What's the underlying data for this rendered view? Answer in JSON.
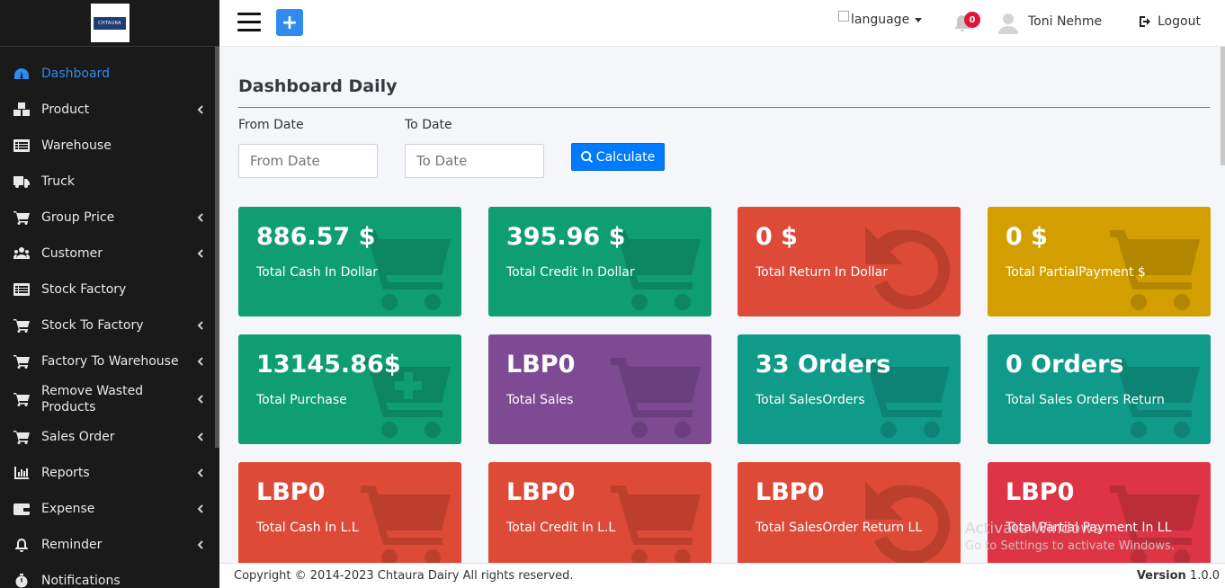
{
  "brand": {
    "logo_text": "CHTAURA"
  },
  "sidebar": {
    "items": [
      {
        "label": "Dashboard",
        "icon": "tachometer-icon",
        "active": true,
        "has_children": false
      },
      {
        "label": "Product",
        "icon": "cubes-icon",
        "active": false,
        "has_children": true
      },
      {
        "label": "Warehouse",
        "icon": "list-icon",
        "active": false,
        "has_children": false
      },
      {
        "label": "Truck",
        "icon": "truck-icon",
        "active": false,
        "has_children": false
      },
      {
        "label": "Group Price",
        "icon": "cart-icon",
        "active": false,
        "has_children": true
      },
      {
        "label": "Customer",
        "icon": "users-icon",
        "active": false,
        "has_children": true
      },
      {
        "label": "Stock Factory",
        "icon": "list-icon",
        "active": false,
        "has_children": false
      },
      {
        "label": "Stock To Factory",
        "icon": "cart-icon",
        "active": false,
        "has_children": true
      },
      {
        "label": "Factory To Warehouse",
        "icon": "cart-icon",
        "active": false,
        "has_children": true
      },
      {
        "label": "Remove Wasted Products",
        "icon": "cart-icon",
        "active": false,
        "has_children": true
      },
      {
        "label": "Sales Order",
        "icon": "cart-icon",
        "active": false,
        "has_children": true
      },
      {
        "label": "Reports",
        "icon": "chart-icon",
        "active": false,
        "has_children": true
      },
      {
        "label": "Expense",
        "icon": "wallet-icon",
        "active": false,
        "has_children": true
      },
      {
        "label": "Reminder",
        "icon": "bell-icon",
        "active": false,
        "has_children": true
      },
      {
        "label": "Notifications",
        "icon": "stopwatch-icon",
        "active": false,
        "has_children": false
      }
    ]
  },
  "topbar": {
    "language_alt": "language",
    "notification_count": "0",
    "username": "Toni Nehme",
    "logout_label": "Logout",
    "accent_color": "#2f8bf0"
  },
  "main": {
    "title": "Dashboard Daily",
    "from_date": {
      "label": "From Date",
      "placeholder": "From Date",
      "value": ""
    },
    "to_date": {
      "label": "To Date",
      "placeholder": "To Date",
      "value": ""
    },
    "calculate_label": "Calculate",
    "cards": [
      {
        "value": "886.57 $",
        "label": "Total Cash In Dollar",
        "color": "#0f9d72",
        "icon": "cart-icon"
      },
      {
        "value": "395.96 $",
        "label": "Total Credit In Dollar",
        "color": "#0f9d72",
        "icon": "cart-icon"
      },
      {
        "value": "0 $",
        "label": "Total Return In Dollar",
        "color": "#dd4a37",
        "icon": "undo-icon"
      },
      {
        "value": "0 $",
        "label": "Total PartialPayment $",
        "color": "#d39e00",
        "icon": "cart-icon"
      },
      {
        "value": "13145.86$",
        "label": "Total Purchase",
        "color": "#0f9d72",
        "icon": "cart-plus-icon"
      },
      {
        "value": "LBP0",
        "label": "Total Sales",
        "color": "#7d4a93",
        "icon": "cart-icon"
      },
      {
        "value": "33 Orders",
        "label": "Total SalesOrders",
        "color": "#0f9a8a",
        "icon": "cart-icon"
      },
      {
        "value": "0 Orders",
        "label": "Total Sales Orders Return",
        "color": "#0f9a8a",
        "icon": "cart-icon"
      },
      {
        "value": "LBP0",
        "label": "Total Cash In L.L",
        "color": "#dd4a37",
        "icon": "cart-icon"
      },
      {
        "value": "LBP0",
        "label": "Total Credit In L.L",
        "color": "#dd4a37",
        "icon": "cart-icon"
      },
      {
        "value": "LBP0",
        "label": "Total SalesOrder Return LL",
        "color": "#dd4a37",
        "icon": "undo-icon"
      },
      {
        "value": "LBP0",
        "label": "Total Partial Payment In LL",
        "color": "#dd3545",
        "icon": "cart-icon"
      }
    ]
  },
  "footer": {
    "copyright": "Copyright © 2014-2023 Chtaura Dairy All rights reserved.",
    "version_label": "Version",
    "version_number": "1.0.0"
  },
  "watermark": {
    "line1": "Activate Windows",
    "line2": "Go to Settings to activate Windows."
  }
}
